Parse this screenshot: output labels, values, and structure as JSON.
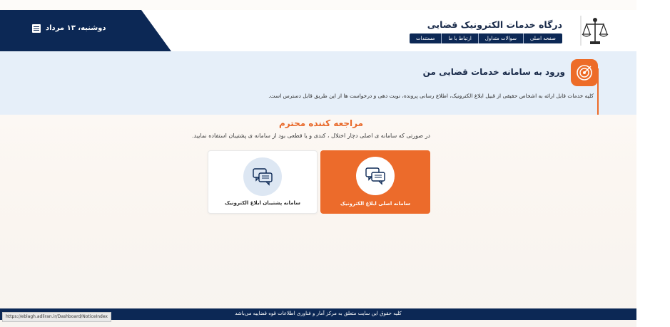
{
  "header": {
    "date": "دوشنبه، ۱۳ مرداد",
    "portal_title": "درگاه خدمات الکترونیک قضایی",
    "nav": [
      {
        "label": "صفحه اصلی"
      },
      {
        "label": "سوالات متداول"
      },
      {
        "label": "ارتباط با ما"
      },
      {
        "label": "مستندات"
      }
    ]
  },
  "notice": {
    "title": "ورود به سامانه خدمات قضایی من",
    "text": "کلیه خدمات قابل ارائه به اشخاص حقیقی از قبیل ابلاغ الکترونیک، اطلاع رسانی پرونده، نوبت دهی و درخواست ها از این طریق قابل دسترس است."
  },
  "main": {
    "greeting": "مراجعه کننده محترم",
    "instruction": "در صورتی که سامانه ی اصلی دچار اختلال ، کندی و یا قطعی بود از سامانه ی پشتیبان استفاده نمایید.",
    "cards": {
      "primary_label": "سامانه اصلی ابلاغ الکترونیک",
      "backup_label": "سامانه پشتیبان ابلاغ الکترونیک"
    }
  },
  "footer": {
    "text": "کلیه حقوق این سایت متعلق به مرکز آمار و فناوری اطلاعات قوه قضاییه می‌باشد",
    "status_url": "https://eblagh.adliran.ir/Dashboard/NoticeIndex"
  },
  "colors": {
    "navy": "#0c2855",
    "accent": "#ec6b2b",
    "notice_bg": "#e6eff9"
  },
  "icons": {
    "emblem": "judiciary-scales-emblem",
    "calendar": "calendar-icon",
    "notice": "target-icon",
    "card": "chat-bubbles-icon"
  }
}
